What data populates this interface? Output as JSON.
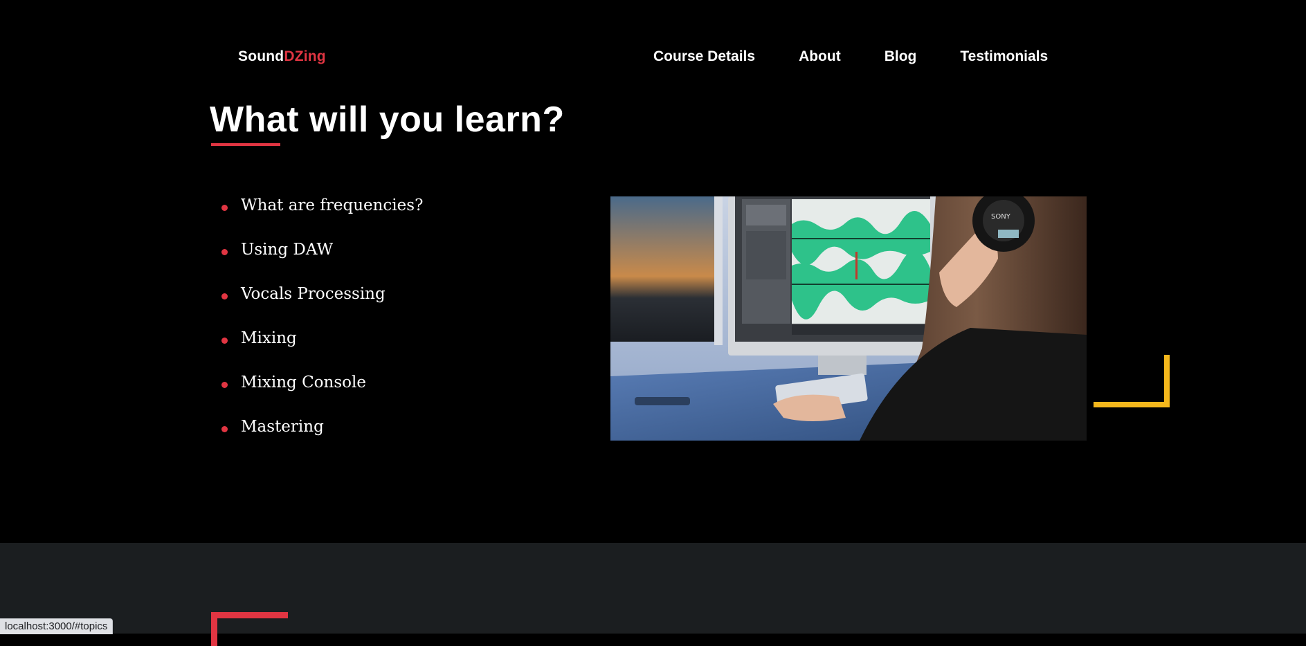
{
  "logo": {
    "part1": "Sound",
    "part2": "DZing"
  },
  "nav": {
    "items": [
      {
        "label": "Course Details"
      },
      {
        "label": "About"
      },
      {
        "label": "Blog"
      },
      {
        "label": "Testimonials"
      }
    ]
  },
  "section": {
    "title": "What will you learn?",
    "topics": [
      "What are frequencies?",
      "Using DAW",
      "Vocals Processing",
      "Mixing",
      "Mixing Console",
      "Mastering"
    ],
    "image_description": "woman with headphones editing audio waveform on a computer"
  },
  "statusbar": {
    "url": "localhost:3000/#topics"
  },
  "colors": {
    "background": "#000000",
    "accent_red": "#e13542",
    "accent_yellow": "#f4b71c",
    "next_section_bg": "#1b1e20"
  }
}
